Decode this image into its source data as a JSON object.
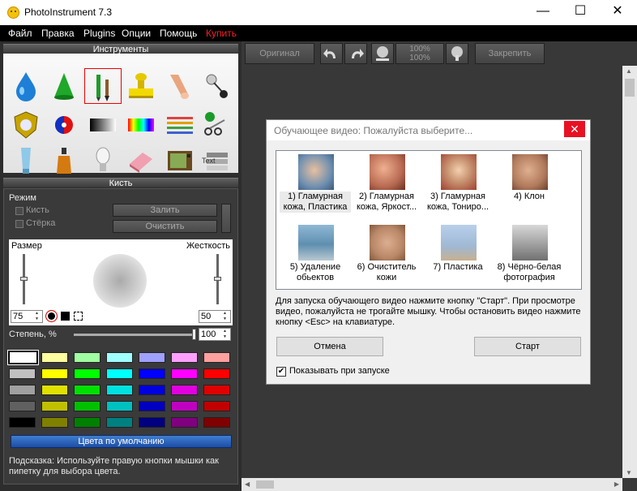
{
  "window": {
    "title": "PhotoInstrument 7.3",
    "minimize": "—",
    "maximize": "☐",
    "close": "✕"
  },
  "menu": [
    "Файл",
    "Правка",
    "Plugins",
    "Опции",
    "Помощь",
    "Купить"
  ],
  "colors": {
    "accent_red": "#e81123",
    "buy_menu": "#ff2020",
    "default_colors_button": "#2a5fba"
  },
  "tools_panel": {
    "title": "Инструменты",
    "tools": [
      "water-drop-icon",
      "cone-icon",
      "brush-pencil-icon",
      "stamp-icon",
      "finger-smudge-icon",
      "pin-icon",
      "shield-icon",
      "color-circle-icon",
      "gradient-icon",
      "rainbow-icon",
      "lines-icon",
      "scissors-icon",
      "tube-icon",
      "bottle-icon",
      "bulb-icon",
      "eraser-icon",
      "tv-icon",
      "text-layers-icon"
    ],
    "text_tool_label": "Text"
  },
  "brush_panel": {
    "title": "Кисть",
    "mode_label": "Режим",
    "mode_brush": "Кисть",
    "mode_eraser": "Стёрка",
    "fill_button": "Залить",
    "clear_button": "Очистить",
    "size_label": "Размер",
    "hardness_label": "Жесткость",
    "size_value": "75",
    "hardness_value": "50",
    "size_level": 0.5,
    "hardness_level": 0.5,
    "degree_label": "Степень, %",
    "degree_value": "100",
    "degree_level": 1.0,
    "default_colors_button": "Цвета по умолчанию",
    "hint": "Подсказка: Используйте правую кнопки мышки как пипетку для выбора цвета.",
    "palette": [
      [
        "#ffffff",
        "#ffffa0",
        "#a0ffa0",
        "#a0ffff",
        "#a0a0ff",
        "#ffa0ff",
        "#ffa0a0"
      ],
      [
        "#c0c0c0",
        "#ffff00",
        "#00ff00",
        "#00ffff",
        "#0000ff",
        "#ff00ff",
        "#ff0000"
      ],
      [
        "#a0a0a0",
        "#e0e000",
        "#00e000",
        "#00e0e0",
        "#0000e0",
        "#e000e0",
        "#e00000"
      ],
      [
        "#606060",
        "#c0c000",
        "#00c000",
        "#00c0c0",
        "#0000c0",
        "#c000c0",
        "#c00000"
      ],
      [
        "#000000",
        "#808000",
        "#008000",
        "#008080",
        "#000080",
        "#800080",
        "#800000"
      ]
    ]
  },
  "toolbar": {
    "original_button": "Оригинал",
    "zoom_top": "100%",
    "zoom_bottom": "100%",
    "pin_button": "Закрепить"
  },
  "dialog": {
    "title": "Обучающее видео: Пожалуйста выберите...",
    "videos": [
      {
        "label": "1) Гламурная кожа, Пластика",
        "thumb": "#6a8fae"
      },
      {
        "label": "2) Гламурная кожа, Яркост...",
        "thumb": "#b86a52"
      },
      {
        "label": "3) Гламурная кожа, Тониро...",
        "thumb": "#c79270"
      },
      {
        "label": "4) Клон",
        "thumb": "#b07a5c"
      },
      {
        "label": "5) Удаление обьектов",
        "thumb": "#7fa7bf"
      },
      {
        "label": "6) Очиститель кожи",
        "thumb": "#b98868"
      },
      {
        "label": "7) Пластика",
        "thumb": "#9fb8d4"
      },
      {
        "label": "8) Чёрно-белая фотография",
        "thumb": "#9a9a9a"
      }
    ],
    "hint": "Для запуска обучающего видео нажмите кнопку \"Старт\". При просмотре видео, пожалуйста не трогайте мышку. Чтобы остановить видео нажмите кнопку <Esc> на клавиатуре.",
    "cancel_button": "Отмена",
    "start_button": "Старт",
    "show_on_start": "Показывать при запуске",
    "show_on_start_checked": true
  }
}
